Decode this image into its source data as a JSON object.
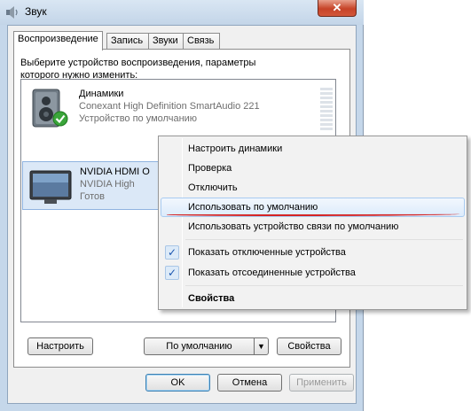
{
  "window": {
    "title": "Звук",
    "close_label": "✕"
  },
  "tabs": [
    {
      "label": "Воспроизведение",
      "active": true
    },
    {
      "label": "Запись",
      "active": false
    },
    {
      "label": "Звуки",
      "active": false
    },
    {
      "label": "Связь",
      "active": false
    }
  ],
  "instructions": "Выберите устройство воспроизведения, параметры которого нужно изменить:",
  "devices": [
    {
      "name": "Динамики",
      "driver": "Conexant High Definition SmartAudio 221",
      "status": "Устройство по умолчанию",
      "icon": "speaker-icon",
      "default_badge": "check-badge-icon"
    },
    {
      "name": "NVIDIA HDMI O",
      "driver": "NVIDIA High",
      "status": "Готов",
      "icon": "monitor-icon"
    }
  ],
  "context_menu": {
    "items": [
      {
        "label": "Настроить динамики"
      },
      {
        "label": "Проверка"
      },
      {
        "label": "Отключить"
      },
      {
        "label": "Использовать по умолчанию",
        "highlighted": true
      },
      {
        "label": "Использовать устройство связи по умолчанию"
      },
      {
        "label": "Показать отключенные устройства",
        "checked": true
      },
      {
        "label": "Показать отсоединенные устройства",
        "checked": true
      },
      {
        "label": "Свойства",
        "bold": true
      }
    ],
    "check_glyph": "✓"
  },
  "buttons": {
    "configure": "Настроить",
    "set_default": "По умолчанию",
    "split_arrow": "▼",
    "properties": "Свойства",
    "ok": "OK",
    "cancel": "Отмена",
    "apply": "Применить"
  },
  "colors": {
    "selection": "#dbe8f7",
    "highlight_underline": "#d42323",
    "check": "#1b56b0"
  }
}
